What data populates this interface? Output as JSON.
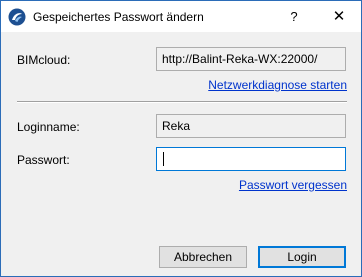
{
  "window": {
    "title": "Gespeichertes Passwort ändern",
    "help_glyph": "?",
    "close_glyph": "✕",
    "app_icon": "bimcloud-logo-icon"
  },
  "form": {
    "server_label": "BIMcloud:",
    "server_value": "http://Balint-Reka-WX:22000/",
    "network_link": "Netzwerkdiagnose starten",
    "login_label": "Loginname:",
    "login_value": "Reka",
    "password_label": "Passwort:",
    "password_value": "",
    "forgot_link": "Passwort vergessen"
  },
  "buttons": {
    "cancel": "Abbrechen",
    "login": "Login"
  },
  "colors": {
    "accent": "#0078d7",
    "link": "#0033cc",
    "window_border": "#2b6cb8"
  }
}
